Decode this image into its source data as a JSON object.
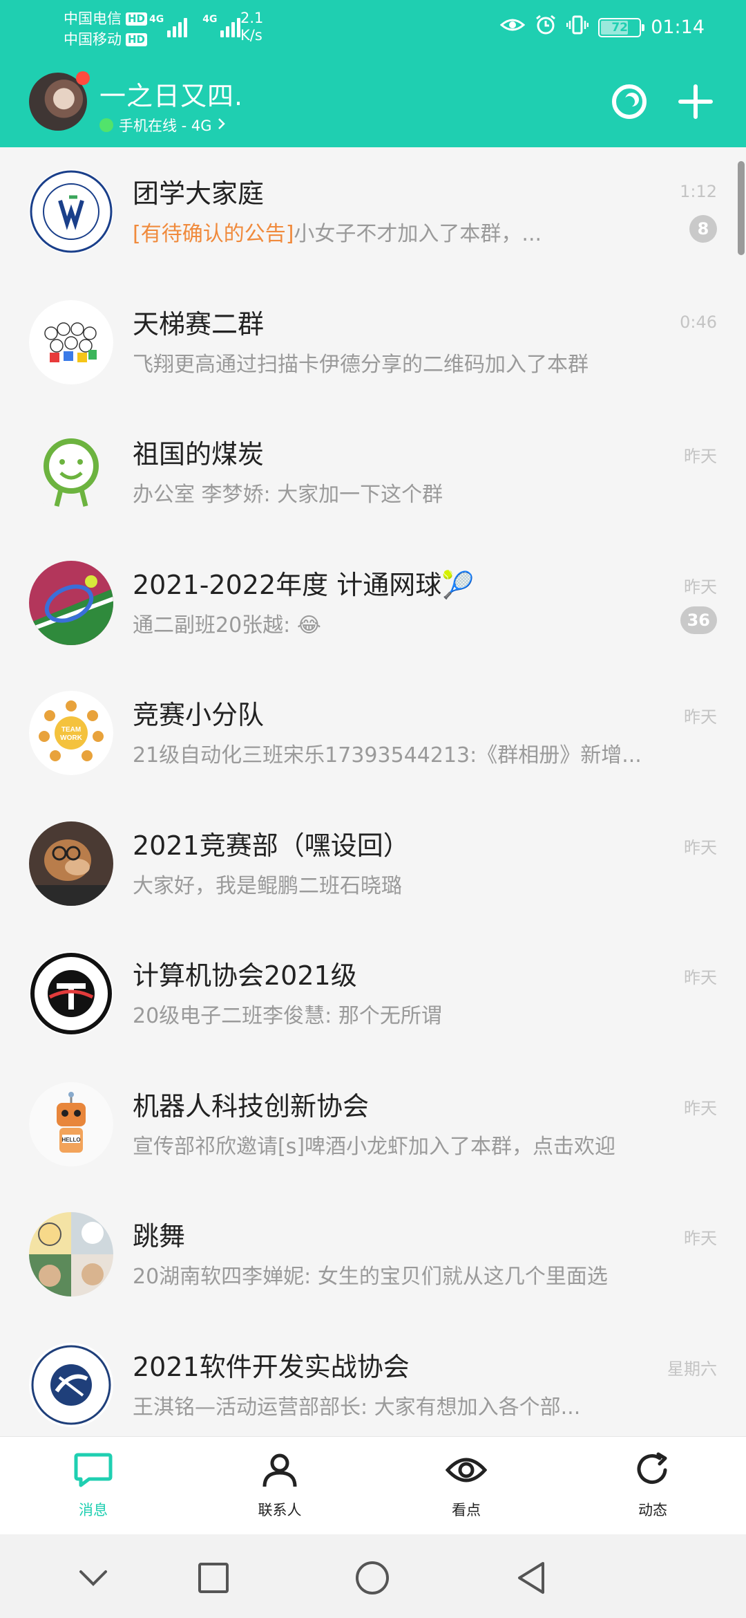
{
  "status_bar": {
    "carrier1": "中国电信",
    "carrier2": "中国移动",
    "hd": "HD",
    "net1": "4G",
    "net2": "4G",
    "speed_value": "2.1",
    "speed_unit": "K/s",
    "battery": "72",
    "battery_level": 0.72,
    "time": "01:14"
  },
  "header": {
    "username": "一之日又四.",
    "online_status": "手机在线 - 4G",
    "icons": [
      "qzone-ring-icon",
      "plus-icon"
    ]
  },
  "chats": [
    {
      "name": "团学大家庭",
      "time": "1:12",
      "preview_highlight": "[有待确认的公告]",
      "preview": "小女子不才加入了本群，...",
      "unread": "8"
    },
    {
      "name": "天梯赛二群",
      "time": "0:46",
      "preview_highlight": "",
      "preview": "飞翔更高通过扫描卡伊德分享的二维码加入了本群",
      "unread": ""
    },
    {
      "name": "祖国的煤炭",
      "time": "昨天",
      "preview_highlight": "",
      "preview": "办公室 李梦娇: 大家加一下这个群",
      "unread": ""
    },
    {
      "name": "2021-2022年度 计通网球🎾",
      "time": "昨天",
      "preview_highlight": "",
      "preview": "通二副班20张越: 😂",
      "unread": "36"
    },
    {
      "name": "竞赛小分队",
      "time": "昨天",
      "preview_highlight": "",
      "preview": "21级自动化三班宋乐17393544213:《群相册》新增...",
      "unread": ""
    },
    {
      "name": "2021竞赛部（嘿设回）",
      "time": "昨天",
      "preview_highlight": "",
      "preview": "大家好，我是鲲鹏二班石晓璐",
      "unread": ""
    },
    {
      "name": "计算机协会2021级",
      "time": "昨天",
      "preview_highlight": "",
      "preview": "20级电子二班李俊慧: 那个无所谓",
      "unread": ""
    },
    {
      "name": "机器人科技创新协会",
      "time": "昨天",
      "preview_highlight": "",
      "preview": "宣传部祁欣邀请[s]啤酒小龙虾加入了本群，点击欢迎",
      "unread": ""
    },
    {
      "name": "跳舞",
      "time": "昨天",
      "preview_highlight": "",
      "preview": "20湖南软四李婵妮: 女生的宝贝们就从这几个里面选",
      "unread": ""
    },
    {
      "name": "2021软件开发实战协会",
      "time": "星期六",
      "preview_highlight": "",
      "preview": "王淇铭—活动运营部部长: 大家有想加入各个部...",
      "unread": ""
    }
  ],
  "tabs": [
    {
      "label": "消息",
      "icon": "message-bubble-icon",
      "active": true
    },
    {
      "label": "联系人",
      "icon": "contact-person-icon",
      "active": false
    },
    {
      "label": "看点",
      "icon": "eye-icon",
      "active": false
    },
    {
      "label": "动态",
      "icon": "refresh-dynamic-icon",
      "active": false
    }
  ],
  "colors": {
    "accent": "#1fcfb1",
    "notice_highlight": "#f08a3c",
    "badge": "#c9c9c9"
  }
}
